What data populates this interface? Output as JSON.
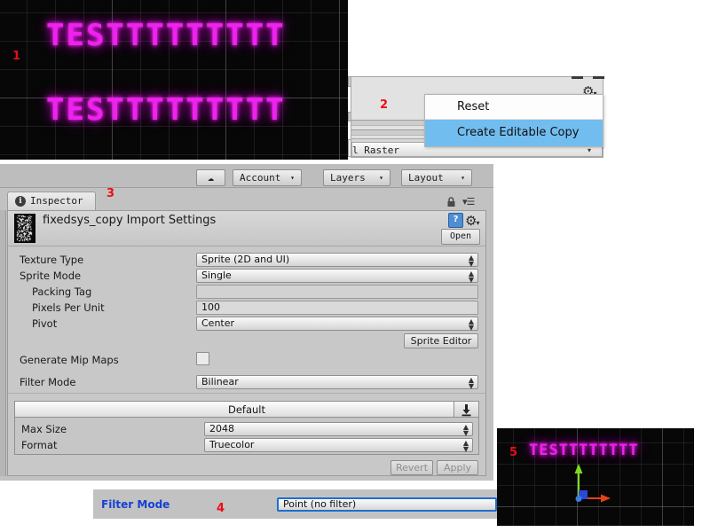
{
  "scene_top": {
    "marker": "1",
    "text_line_1": "TESTTTTTTTTT",
    "text_line_2": "TESTTTTTTTTT",
    "text_color": "#ee22ee",
    "background": "#070707"
  },
  "context_window": {
    "marker": "2",
    "gear_icon": "gear-icon",
    "gear_caret": "▾",
    "raster_label": "l Raster",
    "raster_caret": "▾",
    "menu": {
      "items": [
        {
          "label": "Reset",
          "highlighted": false
        },
        {
          "label": "Create Editable Copy",
          "highlighted": true
        }
      ],
      "highlight_color": "#72bdf0"
    }
  },
  "editor_toolbar": {
    "cloud_button": "☁",
    "buttons": [
      {
        "label": "Account",
        "caret": "▾"
      },
      {
        "label": "Layers",
        "caret": "▾"
      },
      {
        "label": "Layout",
        "caret": "▾"
      }
    ]
  },
  "inspector": {
    "marker": "3",
    "tab_label": "Inspector",
    "tab_icon": "info-icon",
    "tab_icon_glyph": "i",
    "lock_icon": "lock-icon",
    "menu_icon": "hamburger-menu-icon",
    "title": "fixedsys_copy Import Settings",
    "help_icon": "help-book-icon",
    "help_glyph": "?",
    "gear_icon": "gear-icon",
    "open_button": "Open",
    "fields": [
      {
        "label": "Texture Type",
        "value": "Sprite (2D and UI)",
        "control": "popup",
        "indent": 0
      },
      {
        "label": "Sprite Mode",
        "value": "Single",
        "control": "popup",
        "indent": 0
      },
      {
        "label": "Packing Tag",
        "value": "",
        "control": "text",
        "indent": 1
      },
      {
        "label": "Pixels Per Unit",
        "value": "100",
        "control": "text",
        "indent": 1
      },
      {
        "label": "Pivot",
        "value": "Center",
        "control": "popup",
        "indent": 1
      }
    ],
    "sprite_editor_button": "Sprite Editor",
    "mipmaps_label": "Generate Mip Maps",
    "mipmaps_checked": false,
    "filter_mode_label": "Filter Mode",
    "filter_mode_value": "Bilinear",
    "platform_tab": "Default",
    "platform_download_icon": "download-icon",
    "platform_fields": [
      {
        "label": "Max Size",
        "value": "2048"
      },
      {
        "label": "Format",
        "value": "Truecolor"
      }
    ],
    "revert_button": "Revert",
    "apply_button": "Apply",
    "buttons_disabled": true
  },
  "filter_mode_strip": {
    "marker": "4",
    "label": "Filter Mode",
    "label_color": "#1740d4",
    "value": "Point (no filter)",
    "border_color": "#1f6fd0"
  },
  "scene_bottom": {
    "marker": "5",
    "text": "TESTTTTTTTT",
    "gizmo": {
      "y_axis_color": "#7ddb1e",
      "x_axis_color": "#e0431a",
      "z_handle_color": "#2a49d8",
      "origin_color": "#3b7de0"
    }
  }
}
